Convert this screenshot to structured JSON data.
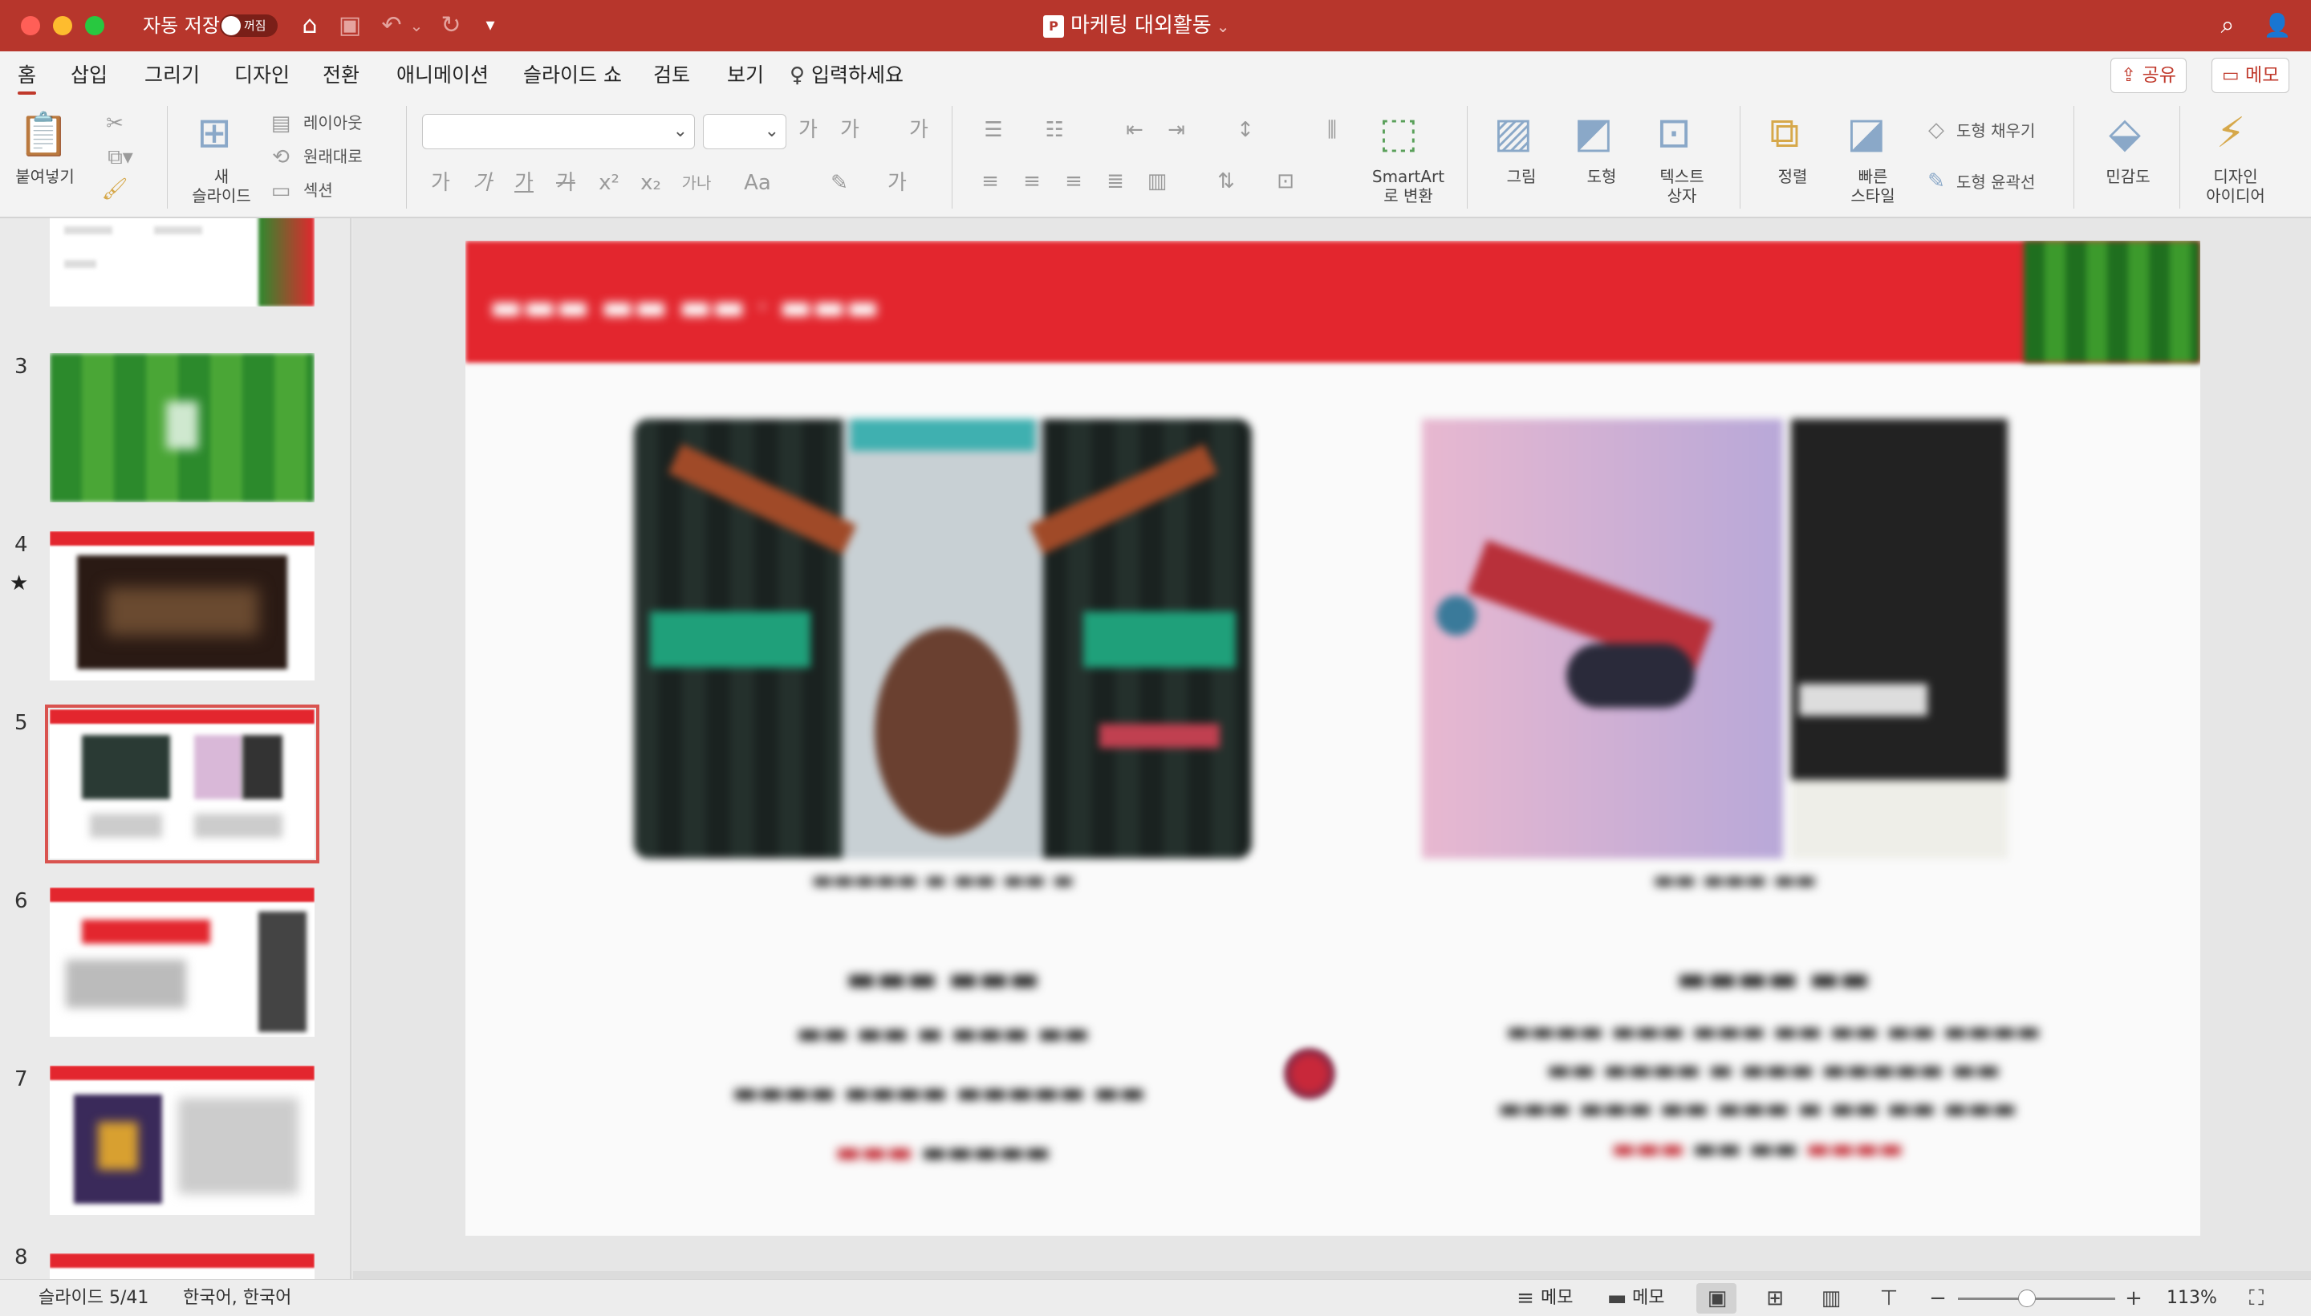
{
  "titlebar": {
    "autosave_label": "자동 저장",
    "autosave_state": "꺼짐",
    "doc_title": "마케팅 대외활동",
    "doc_title_chevron": "⌄",
    "app_badge": "P",
    "home_icon": "⌂",
    "save_icon": "▣",
    "undo_icon": "↶",
    "redo_icon": "↻",
    "customize_icon": "▾",
    "search_icon": "⌕",
    "account_icon": "👤",
    "colors": {
      "titlebar": "#b7362c",
      "accent": "#c0392b"
    }
  },
  "tabs": [
    {
      "label": "홈",
      "active": true
    },
    {
      "label": "삽입"
    },
    {
      "label": "그리기"
    },
    {
      "label": "디자인"
    },
    {
      "label": "전환"
    },
    {
      "label": "애니메이션"
    },
    {
      "label": "슬라이드 쇼"
    },
    {
      "label": "검토"
    },
    {
      "label": "보기"
    }
  ],
  "tellme": {
    "label": "입력하세요",
    "icon": "bulb-icon"
  },
  "share_button": {
    "label": "공유",
    "icon": "share-icon"
  },
  "memo_button": {
    "label": "메모",
    "icon": "comment-icon"
  },
  "ribbon": {
    "paste": {
      "label": "붙여넣기"
    },
    "new_slide": {
      "label_line1": "새",
      "label_line2": "슬라이드"
    },
    "layout": {
      "label": "레이아웃"
    },
    "reset": {
      "label": "원래대로"
    },
    "section": {
      "label": "섹션"
    },
    "font_buttons": [
      "가",
      "가",
      "가",
      "가",
      "x²",
      "x₂",
      "가나",
      "Aa"
    ],
    "smartart": {
      "label_line1": "SmartArt",
      "label_line2": "로 변환"
    },
    "picture": {
      "label": "그림"
    },
    "shapes": {
      "label": "도형"
    },
    "textbox": {
      "label_line1": "텍스트",
      "label_line2": "상자"
    },
    "arrange": {
      "label": "정렬"
    },
    "quickstyles": {
      "label_line1": "빠른",
      "label_line2": "스타일"
    },
    "shape_fill": {
      "label": "도형 채우기"
    },
    "shape_outline": {
      "label": "도형 윤곽선"
    },
    "sensitivity": {
      "label": "민감도"
    },
    "designer": {
      "label_line1": "디자인",
      "label_line2": "아이디어"
    }
  },
  "thumbnails": [
    {
      "number": "",
      "kind": "partial"
    },
    {
      "number": "3",
      "kind": "green"
    },
    {
      "number": "4",
      "kind": "dark"
    },
    {
      "number": "5",
      "kind": "selected"
    },
    {
      "number": "6",
      "kind": "red-text"
    },
    {
      "number": "7",
      "kind": "poster"
    },
    {
      "number": "8",
      "kind": "partial-bottom"
    }
  ],
  "statusbar": {
    "slide_indicator": "슬라이드 5/41",
    "language": "한국어, 한국어",
    "notes_label": "메모",
    "comments_label": "메모",
    "zoom_minus": "−",
    "zoom_plus": "+",
    "zoom_level": "113%",
    "zoom_fraction": 0.44
  }
}
